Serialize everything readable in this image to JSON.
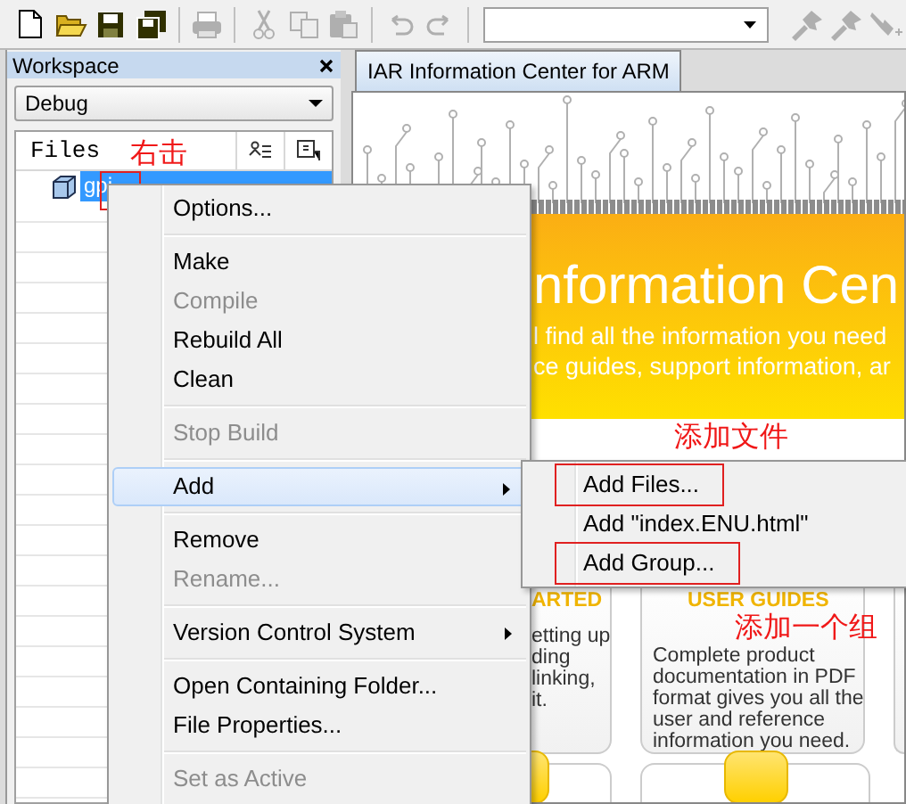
{
  "toolbar": {
    "buttons": [
      {
        "kind": "new",
        "disabled": false
      },
      {
        "kind": "open",
        "disabled": false
      },
      {
        "kind": "save",
        "disabled": false
      },
      {
        "kind": "save_all",
        "disabled": false
      },
      {
        "kind": "separator"
      },
      {
        "kind": "print",
        "disabled": true
      },
      {
        "kind": "separator"
      },
      {
        "kind": "cut",
        "disabled": true
      },
      {
        "kind": "copy",
        "disabled": true
      },
      {
        "kind": "paste",
        "disabled": true
      },
      {
        "kind": "separator"
      },
      {
        "kind": "undo",
        "disabled": true
      },
      {
        "kind": "redo",
        "disabled": true
      },
      {
        "kind": "separator"
      },
      {
        "kind": "combo"
      },
      {
        "kind": "tool",
        "disabled": true
      },
      {
        "kind": "tool",
        "disabled": true
      },
      {
        "kind": "tool_add",
        "disabled": true
      }
    ]
  },
  "workspace": {
    "title": "Workspace",
    "configuration": "Debug",
    "column": "Files",
    "tree": [
      {
        "label": "gpi",
        "selected": true,
        "marked": true
      }
    ]
  },
  "info_center": {
    "tab": {
      "label": "IAR Information Center for ARM",
      "selected": true
    },
    "banner": {
      "title": "nformation Cen",
      "lines": [
        "l find all the information you need",
        "ce guides, support information, ar"
      ]
    },
    "cards": [
      {
        "title": "ARTED",
        "lines": [
          "etting up",
          "ding",
          "linking,",
          "it."
        ]
      },
      {
        "title": "USER GUIDES",
        "lines": [
          "Complete product",
          "documentation in PDF",
          "format gives you all the",
          "user and reference",
          "information you need."
        ]
      }
    ]
  },
  "context_menu": {
    "items": [
      {
        "kind": "item",
        "label": "Options...",
        "disabled": false,
        "selected": false,
        "submenu": false
      },
      {
        "kind": "separator"
      },
      {
        "kind": "item",
        "label": "Make",
        "disabled": false,
        "selected": false,
        "submenu": false
      },
      {
        "kind": "item",
        "label": "Compile",
        "disabled": true,
        "selected": false,
        "submenu": false
      },
      {
        "kind": "item",
        "label": "Rebuild All",
        "disabled": false,
        "selected": false,
        "submenu": false
      },
      {
        "kind": "item",
        "label": "Clean",
        "disabled": false,
        "selected": false,
        "submenu": false
      },
      {
        "kind": "separator"
      },
      {
        "kind": "item",
        "label": "Stop Build",
        "disabled": true,
        "selected": false,
        "submenu": false
      },
      {
        "kind": "separator"
      },
      {
        "kind": "item",
        "label": "Add",
        "disabled": false,
        "selected": true,
        "submenu": true
      },
      {
        "kind": "separator"
      },
      {
        "kind": "item",
        "label": "Remove",
        "disabled": false,
        "selected": false,
        "submenu": false
      },
      {
        "kind": "item",
        "label": "Rename...",
        "disabled": true,
        "selected": false,
        "submenu": false
      },
      {
        "kind": "separator"
      },
      {
        "kind": "item",
        "label": "Version Control System",
        "disabled": false,
        "selected": false,
        "submenu": true
      },
      {
        "kind": "separator"
      },
      {
        "kind": "item",
        "label": "Open Containing Folder...",
        "disabled": false,
        "selected": false,
        "submenu": false
      },
      {
        "kind": "item",
        "label": "File Properties...",
        "disabled": false,
        "selected": false,
        "submenu": false
      },
      {
        "kind": "separator"
      },
      {
        "kind": "item",
        "label": "Set as Active",
        "disabled": true,
        "selected": false,
        "submenu": false
      }
    ]
  },
  "submenu": {
    "items": [
      {
        "label": "Add Files...",
        "marked": true
      },
      {
        "label": "Add \"index.ENU.html\"",
        "marked": false
      },
      {
        "label": "Add Group...",
        "marked": true
      }
    ]
  },
  "annotations": [
    {
      "text": "右击"
    },
    {
      "text": "添加文件"
    },
    {
      "text": "添加一个组"
    }
  ]
}
